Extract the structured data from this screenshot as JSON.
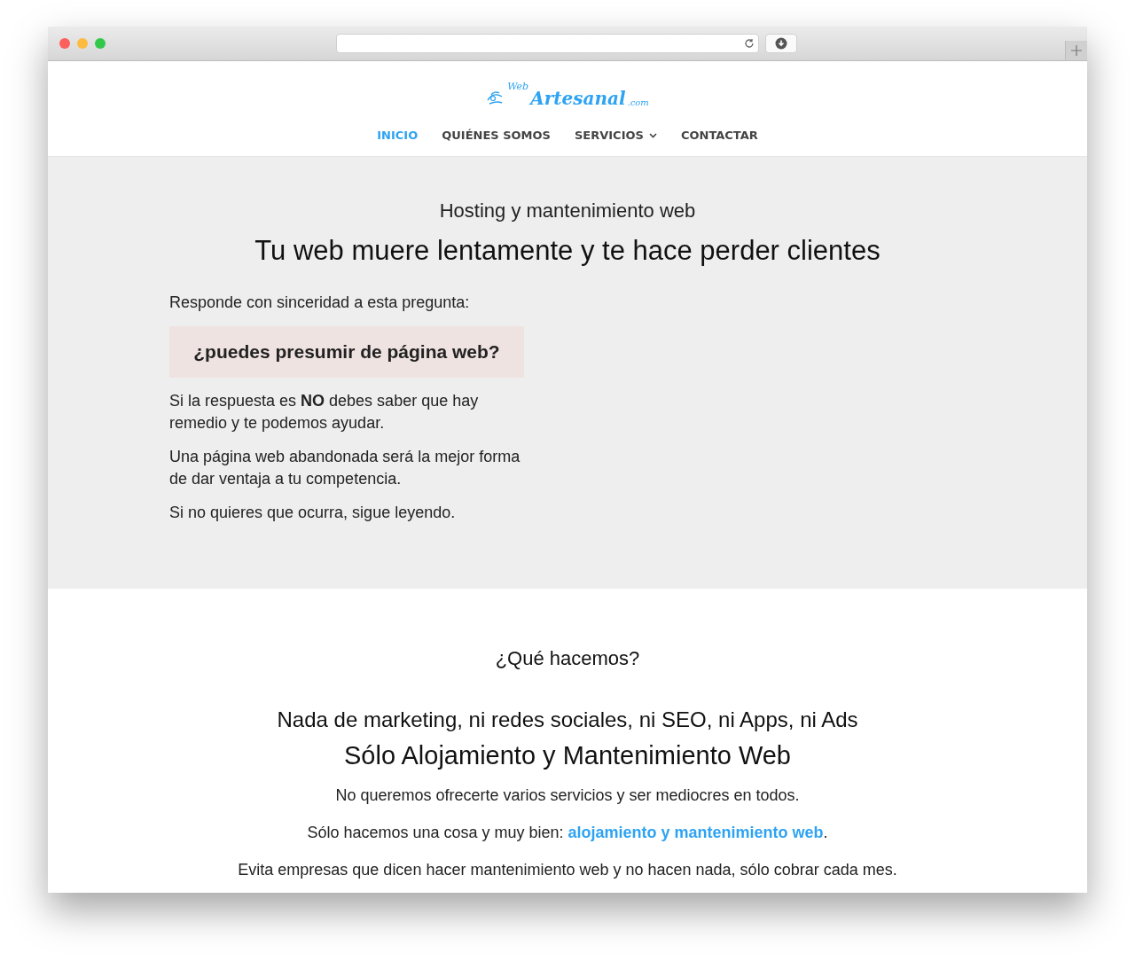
{
  "logo": {
    "small": "Web",
    "main": "Artesanal",
    "suffix": ".com"
  },
  "nav": [
    {
      "label": "INICIO",
      "selected": true,
      "dropdown": false
    },
    {
      "label": "QUIÉNES SOMOS",
      "selected": false,
      "dropdown": false
    },
    {
      "label": "SERVICIOS",
      "selected": false,
      "dropdown": true
    },
    {
      "label": "CONTACTAR",
      "selected": false,
      "dropdown": false
    }
  ],
  "hero": {
    "subtitle": "Hosting y mantenimiento web",
    "title": "Tu web muere lentamente y te hace perder clientes",
    "intro": "Responde con sinceridad a esta pregunta:",
    "question": "¿puedes presumir de página web?",
    "paragraphs": [
      "Si la respuesta es **NO** debes saber que hay remedio y te podemos ayudar.",
      "Una página web abandonada será la mejor forma de dar ventaja a tu competencia.",
      "Si no quieres que ocurra, sigue leyendo."
    ]
  },
  "about": {
    "heading": "¿Qué hacemos?",
    "line_1": "Nada de marketing, ni redes sociales, ni SEO, ni Apps, ni Ads",
    "line_2": "Sólo Alojamiento y Mantenimiento Web",
    "text_1": "No queremos ofrecerte varios servicios y ser mediocres en todos.",
    "text_2": {
      "before": "Sólo hacemos una cosa y muy bien: ",
      "link": "alojamiento y mantenimiento web",
      "after": "."
    },
    "text_3": "Evita empresas que dicen hacer mantenimiento web y no hacen nada, sólo cobrar cada mes."
  }
}
